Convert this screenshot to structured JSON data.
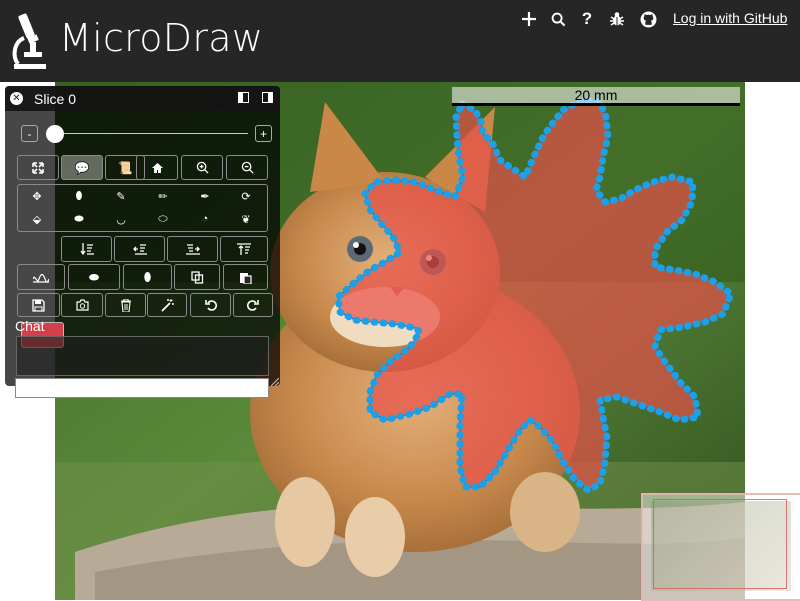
{
  "header": {
    "app_title": "MicroDraw",
    "login_label": "Log in with GitHub",
    "icons": [
      "plus-icon",
      "search-icon",
      "question-icon",
      "bug-icon",
      "github-icon"
    ]
  },
  "viewer": {
    "scale_label": "20 mm"
  },
  "panel": {
    "title": "Slice 0",
    "slider_minus": "-",
    "slider_plus": "+",
    "slider_value": 0,
    "chat_label": "Chat",
    "chat_input_placeholder": "",
    "selected_color": "#d2404a"
  },
  "colors": {
    "header_bg": "#262626",
    "annotation_fill": "#e8504a",
    "annotation_dots": "#1da0e6"
  }
}
